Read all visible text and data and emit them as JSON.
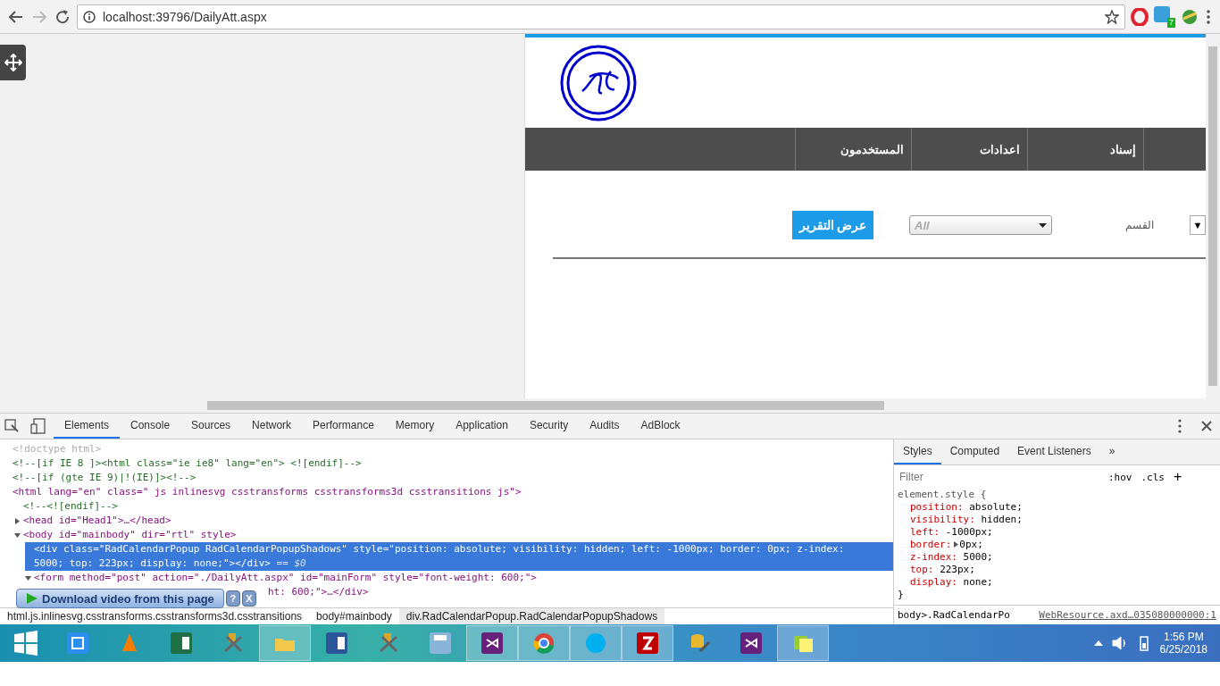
{
  "browser": {
    "url": "localhost:39796/DailyAtt.aspx",
    "extension_badge": "7"
  },
  "page": {
    "nav": [
      {
        "kind": "empty"
      },
      {
        "label": "إسناد",
        "kind": "item"
      },
      {
        "label": "اعدادات",
        "kind": "item"
      },
      {
        "label": "المستخدمون",
        "kind": "item"
      },
      {
        "kind": "fill"
      }
    ],
    "form": {
      "small_select_arrow": "▼",
      "section_label": "القسم",
      "section_value": "All",
      "submit": "عرض التقرير"
    }
  },
  "devtools": {
    "tabs": [
      {
        "label": "Elements",
        "selected": true
      },
      {
        "label": "Console",
        "selected": false
      },
      {
        "label": "Sources",
        "selected": false
      },
      {
        "label": "Network",
        "selected": false
      },
      {
        "label": "Performance",
        "selected": false
      },
      {
        "label": "Memory",
        "selected": false
      },
      {
        "label": "Application",
        "selected": false
      },
      {
        "label": "Security",
        "selected": false
      },
      {
        "label": "Audits",
        "selected": false
      },
      {
        "label": "AdBlock",
        "selected": false
      }
    ],
    "tree": [
      {
        "kind": "doctype",
        "text": "<!doctype html>",
        "selected": false
      },
      {
        "kind": "comment",
        "text": "<!--[if IE 8 ]><html class=\"ie ie8\" lang=\"en\"> <![endif]-->",
        "selected": false
      },
      {
        "kind": "comment",
        "text": "<!--[if (gte IE 9)|!(IE)]><!-->",
        "selected": false
      },
      {
        "kind": "element",
        "text": "<html lang=\"en\" class=\" js inlinesvg csstransforms csstransforms3d csstransitions js\">",
        "selected": false,
        "children": [
          {
            "kind": "comment",
            "text": "<!--<![endif]-->",
            "selected": false
          },
          {
            "kind": "element",
            "text": "<head id=\"Head1\">…</head>",
            "selected": false,
            "expanded": false
          },
          {
            "kind": "element",
            "text": "<body id=\"mainbody\" dir=\"rtl\" style>",
            "selected": false,
            "expanded": true,
            "children": [
              {
                "kind": "element",
                "text": "<div class=\"RadCalendarPopup RadCalendarPopupShadows\" style=\"position: absolute; visibility: hidden; left: -1000px; border: 0px; z-index: 5000; top: 223px; display: none;\"></div>",
                "suffix": "== $0",
                "selected": true
              },
              {
                "kind": "element",
                "text": "<form method=\"post\" action=\"./DailyAtt.aspx\" id=\"mainForm\" style=\"font-weight: 600;\">",
                "selected": false,
                "expanded": true,
                "children": [
                  {
                    "kind": "partial",
                    "text": "ht: 600;\">…</div>",
                    "selected": false
                  }
                ]
              }
            ]
          }
        ]
      }
    ],
    "breadcrumbs": [
      {
        "label": "html.js.inlinesvg.csstransforms.csstransforms3d.csstransitions",
        "selected": false
      },
      {
        "label": "body#mainbody",
        "selected": false
      },
      {
        "label": "div.RadCalendarPopup.RadCalendarPopupShadows",
        "selected": true
      }
    ],
    "styles": {
      "tabs": [
        {
          "label": "Styles",
          "selected": true
        },
        {
          "label": "Computed",
          "selected": false
        },
        {
          "label": "Event Listeners",
          "selected": false
        }
      ],
      "more": "»",
      "filter_placeholder": "Filter",
      "hov": ":hov",
      "cls": ".cls",
      "add": "+",
      "rule": {
        "selector": "element.style {",
        "close": "}",
        "props": [
          {
            "name": "position:",
            "value": "absolute;"
          },
          {
            "name": "visibility:",
            "value": "hidden;"
          },
          {
            "name": "left:",
            "value": "-1000px;"
          },
          {
            "name": "border:",
            "value": "0px;",
            "expandable": true
          },
          {
            "name": "z-index:",
            "value": "5000;"
          },
          {
            "name": "top:",
            "value": "223px;"
          },
          {
            "name": "display:",
            "value": "none;"
          }
        ]
      },
      "next_selector": "body>.RadCalendarPo",
      "next_source": "WebResource.axd…035080000000:1"
    }
  },
  "overlay": {
    "label": "Download video from this page",
    "help": "?",
    "close": "X"
  },
  "taskbar": {
    "apps": [
      {
        "kind": "capture",
        "selected": false
      },
      {
        "kind": "vlc",
        "selected": false
      },
      {
        "kind": "excel",
        "selected": false
      },
      {
        "kind": "tools",
        "selected": false
      },
      {
        "kind": "explorer",
        "selected": true
      },
      {
        "kind": "word",
        "selected": false
      },
      {
        "kind": "tools",
        "selected": false
      },
      {
        "kind": "calculator",
        "selected": false
      },
      {
        "kind": "vs",
        "selected": true
      },
      {
        "kind": "chrome",
        "selected": true
      },
      {
        "kind": "skype",
        "selected": true
      },
      {
        "kind": "filezilla",
        "selected": true
      },
      {
        "kind": "database",
        "selected": false
      },
      {
        "kind": "vs",
        "selected": false
      },
      {
        "kind": "notes",
        "selected": true
      }
    ],
    "time": "1:56 PM",
    "date": "6/25/2018"
  }
}
